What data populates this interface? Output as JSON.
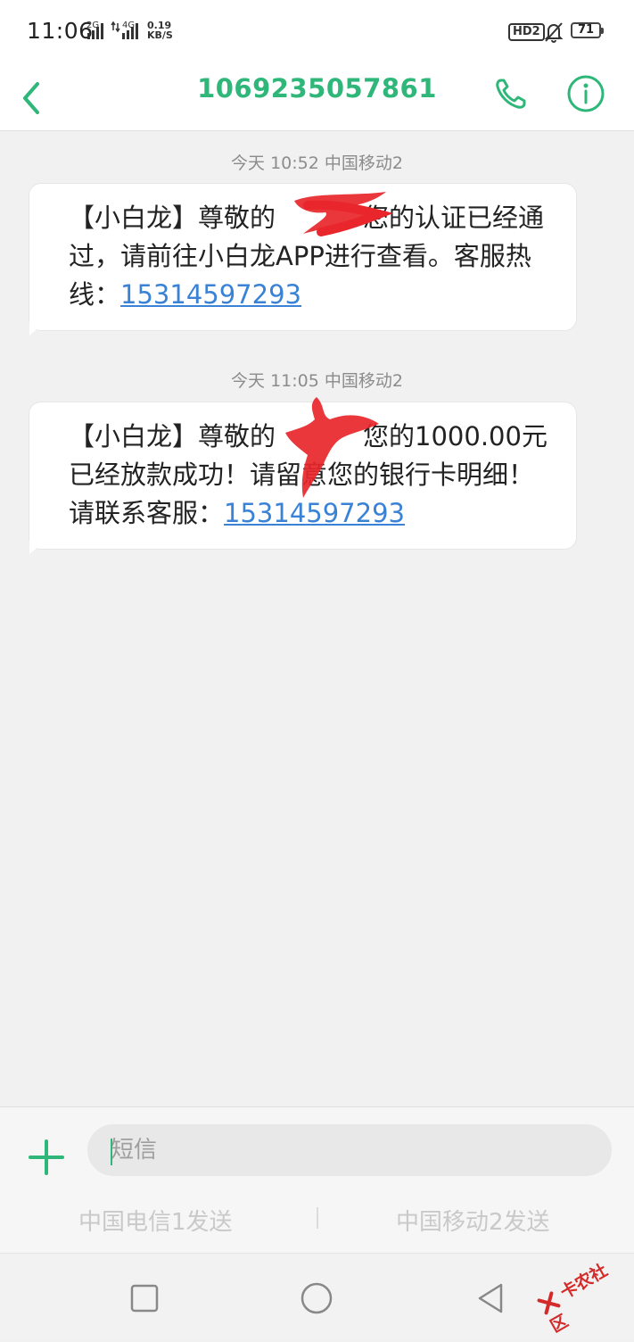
{
  "status_bar": {
    "time": "11:06",
    "sim1_tag": "2G",
    "sim2_tag": "4G",
    "net_speed_value": "0.19",
    "net_speed_unit": "KB/S",
    "hd_badge": "HD2",
    "battery": "71"
  },
  "header": {
    "title": "1069235057861"
  },
  "messages": [
    {
      "timestamp": "今天 10:52  中国移动2",
      "text_before": "【小白龙】尊敬的",
      "text_middle": "您的认证已经通过，请前往小白龙APP进行查看。客服热线：",
      "phone": "15314597293"
    },
    {
      "timestamp": "今天 11:05  中国移动2",
      "text_before": "【小白龙】尊敬的",
      "text_middle": "您的1000.00元已经放款成功！请留意您的银行卡明细！请联系客服：",
      "phone": "15314597293"
    }
  ],
  "compose": {
    "placeholder": "短信",
    "send_sim1": "中国电信1发送",
    "send_sim2": "中国移动2发送"
  },
  "watermark": "卡农社区",
  "colors": {
    "accent": "#2fb77a",
    "link": "#3a82d6",
    "redaction": "#e8262b"
  }
}
